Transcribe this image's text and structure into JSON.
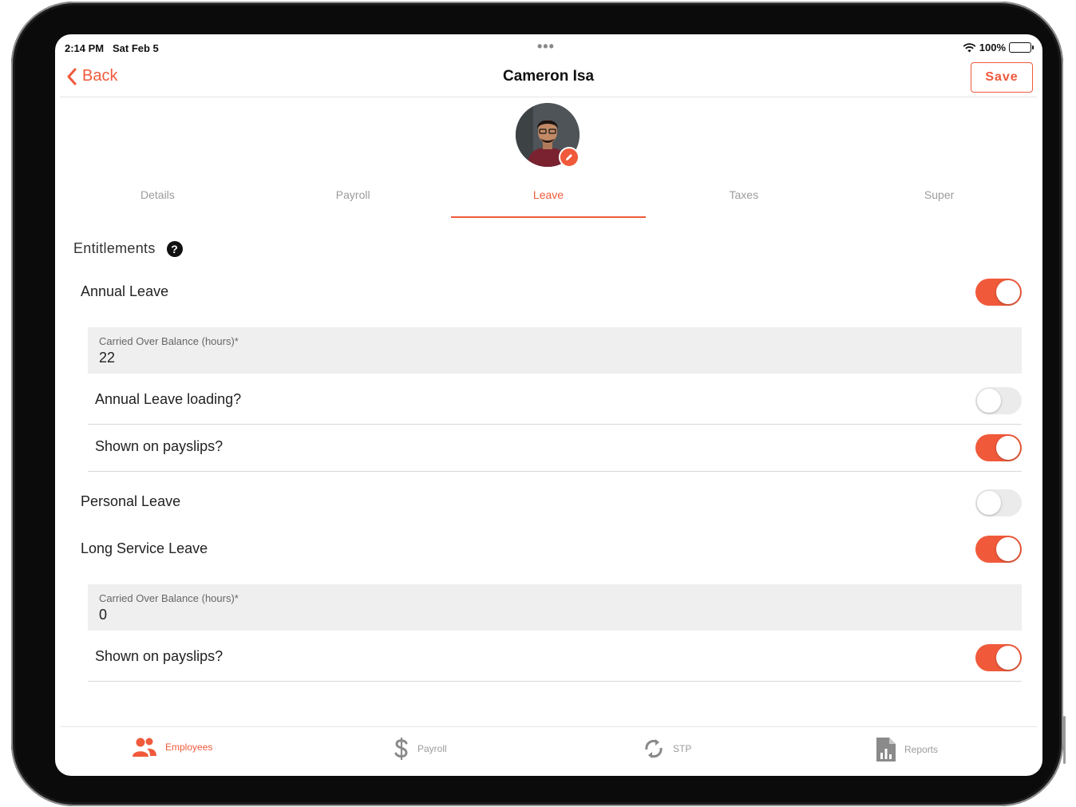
{
  "status_bar": {
    "time": "2:14 PM",
    "date": "Sat Feb 5",
    "battery": "100%",
    "dots": "•••"
  },
  "nav": {
    "back_label": "Back",
    "title": "Cameron Isa",
    "save_label": "Save"
  },
  "tabs": [
    {
      "label": "Details",
      "active": false
    },
    {
      "label": "Payroll",
      "active": false
    },
    {
      "label": "Leave",
      "active": true
    },
    {
      "label": "Taxes",
      "active": false
    },
    {
      "label": "Super",
      "active": false
    }
  ],
  "entitlements": {
    "heading": "Entitlements",
    "help_glyph": "?",
    "annual_leave": {
      "label": "Annual Leave",
      "enabled": true,
      "carried_over_label": "Carried Over Balance (hours)*",
      "carried_over_value": "22",
      "loading_label": "Annual Leave loading?",
      "loading_enabled": false,
      "payslip_label": "Shown on payslips?",
      "payslip_enabled": true
    },
    "personal_leave": {
      "label": "Personal Leave",
      "enabled": false
    },
    "long_service_leave": {
      "label": "Long Service Leave",
      "enabled": true,
      "carried_over_label": "Carried Over Balance (hours)*",
      "carried_over_value": "0",
      "payslip_label": "Shown on payslips?",
      "payslip_enabled": true
    }
  },
  "bottom_tabs": [
    {
      "label": "Employees",
      "icon": "people-icon",
      "active": true
    },
    {
      "label": "Payroll",
      "icon": "dollar-icon",
      "active": false
    },
    {
      "label": "STP",
      "icon": "sync-icon",
      "active": false
    },
    {
      "label": "Reports",
      "icon": "report-icon",
      "active": false
    }
  ],
  "colors": {
    "accent": "#f05a3b",
    "toggle_off": "#ebebeb",
    "field_bg": "#efefef"
  }
}
